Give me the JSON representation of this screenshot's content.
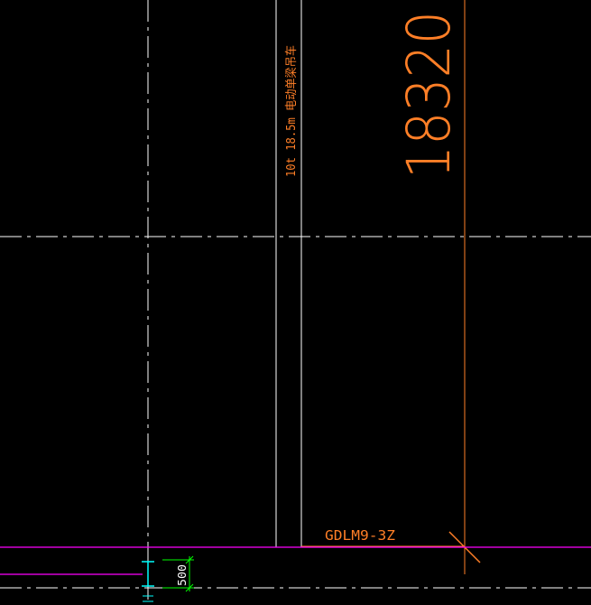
{
  "drawing": {
    "background": "#000000",
    "colors": {
      "grid_line": "#ffffff",
      "crane_rail": "#ffffff",
      "annotation": "#ff7f27",
      "dimension": "#ff7f27",
      "wall_line": "#ff00ff",
      "column": "#00ffff",
      "dim_small": "#00ff00"
    },
    "crane_label": "10t 18.5m 电动单梁吊车",
    "dimension_value": "18320",
    "door_label": "GDLM9-3Z",
    "small_dimension": "500"
  }
}
